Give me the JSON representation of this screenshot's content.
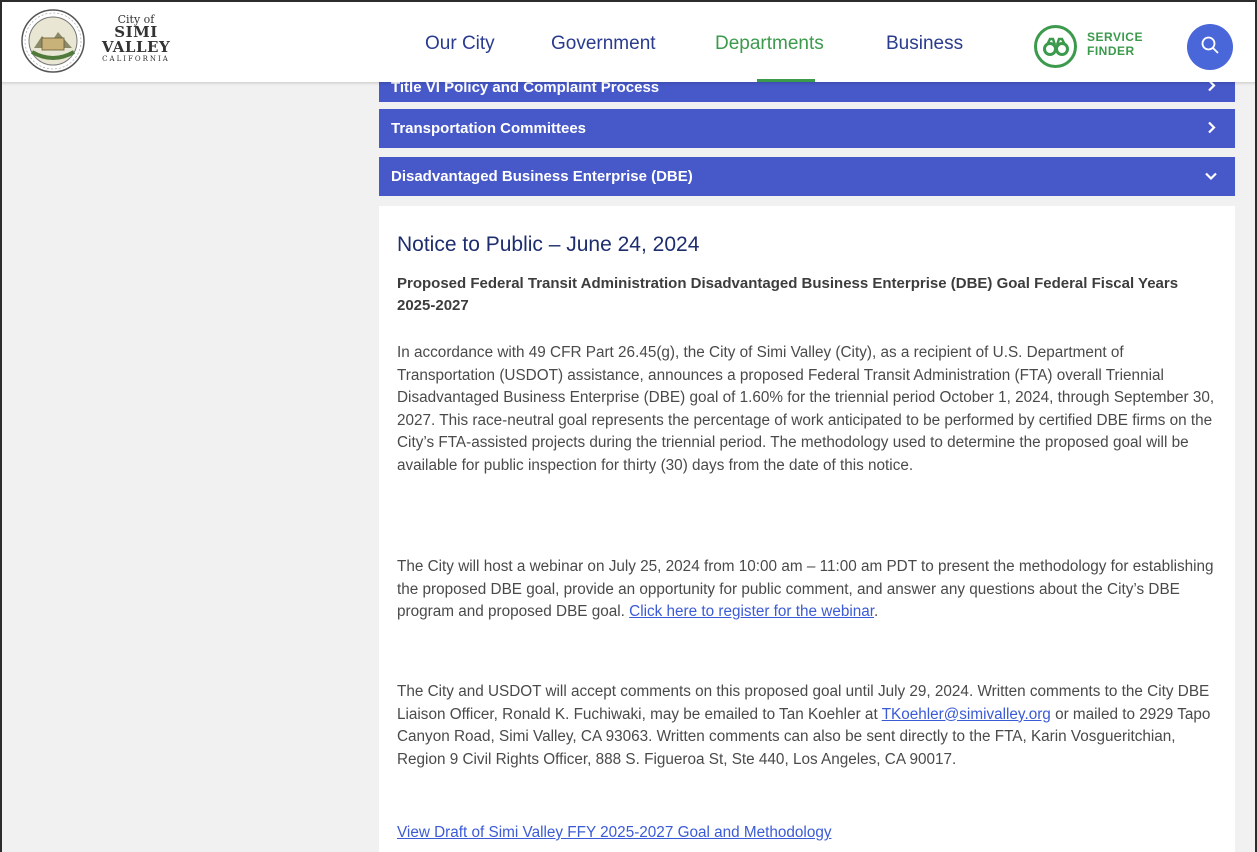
{
  "header": {
    "logo": {
      "line1": "City of",
      "line2": "SIMI",
      "line3": "VALLEY",
      "line4": "CALIFORNIA"
    },
    "nav": [
      {
        "label": "Our City"
      },
      {
        "label": "Government"
      },
      {
        "label": "Departments",
        "active": true
      },
      {
        "label": "Business"
      }
    ],
    "service_finder": {
      "line1": "SERVICE",
      "line2": "FINDER"
    },
    "colors": {
      "nav_text": "#2a3b8f",
      "active": "#3c9a4c",
      "search_bg": "#4a67d9"
    }
  },
  "accordions": [
    {
      "label": "Title VI Policy and Complaint Process",
      "state": "collapsed"
    },
    {
      "label": "Transportation Committees",
      "state": "collapsed"
    },
    {
      "label": "Disadvantaged Business Enterprise (DBE)",
      "state": "expanded"
    }
  ],
  "content": {
    "notice_title": "Notice to Public – June 24, 2024",
    "goal_title": "Proposed Federal Transit Administration Disadvantaged Business Enterprise (DBE) Goal Federal Fiscal Years 2025-2027",
    "p1": "In accordance with 49 CFR Part 26.45(g), the City of Simi Valley (City), as a recipient of U.S. Department of Transportation (USDOT) assistance, announces a proposed Federal Transit Administration (FTA) overall Triennial Disadvantaged Business Enterprise (DBE) goal of 1.60% for the triennial period October 1, 2024, through September 30, 2027. This race-neutral goal represents the percentage of work anticipated to be performed by certified DBE firms on the City’s FTA-assisted projects during the triennial period. The methodology used to determine the proposed goal will be available for public inspection for thirty (30) days from the date of this notice.",
    "p2_text": "The City will host a webinar on July 25, 2024 from 10:00 am – 11:00 am PDT to present the methodology for establishing the proposed DBE goal, provide an opportunity for public comment, and answer any questions about the City’s DBE program and proposed DBE goal.",
    "p2_link": "Click here to register for the webinar",
    "p2_end": ".",
    "p3_a": "The City and USDOT will accept comments on this proposed goal until July 29, 2024. Written comments to the City DBE Liaison Officer, Ronald K. Fuchiwaki, may be emailed to Tan Koehler at",
    "p3_email": "TKoehler@simivalley.org",
    "p3_b": "or mailed to 2929 Tapo Canyon Road, Simi Valley, CA 93063. Written comments can also be sent directly to the FTA, Karin Vosgueritchian, Region 9 Civil Rights Officer, 888 S. Figueroa St, Ste 440, Los Angeles, CA 90017.",
    "draft_link": "View Draft of Simi Valley FFY 2025-2027 Goal and Methodology"
  }
}
